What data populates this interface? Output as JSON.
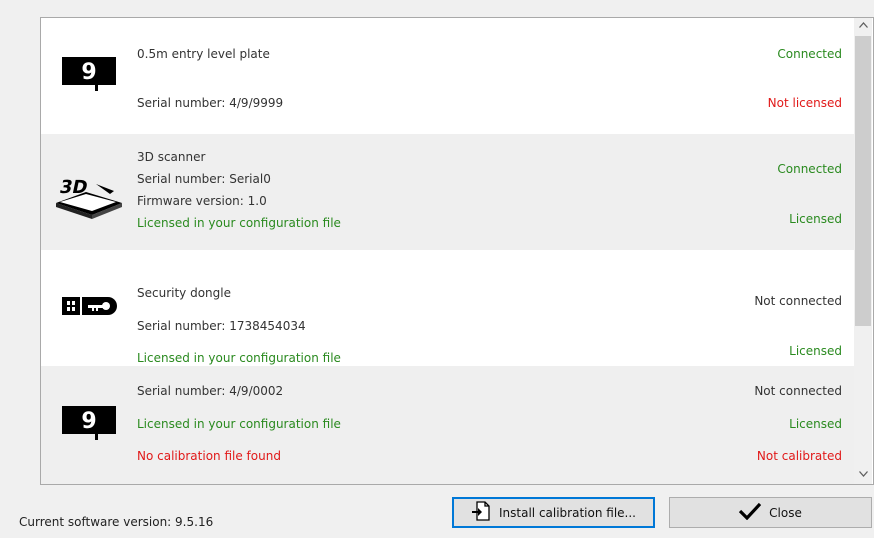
{
  "devices": [
    {
      "icon": "number-9-plate-icon",
      "name": "0.5m entry level plate",
      "serial": "Serial number: 4/9/9999",
      "connection": "Connected",
      "license": "Not licensed"
    },
    {
      "icon": "3d-scanner-icon",
      "name": "3D scanner",
      "serial": "Serial number: Serial0",
      "firmware": "Firmware version: 1.0",
      "license_note": "Licensed in your configuration file",
      "connection": "Connected",
      "license": "Licensed"
    },
    {
      "icon": "security-dongle-icon",
      "name": "Security dongle",
      "serial": "Serial number: 1738454034",
      "license_note": "Licensed in your configuration file",
      "connection": "Not connected",
      "license": "Licensed"
    },
    {
      "icon": "number-9-plate-icon",
      "serial": "Serial number: 4/9/0002",
      "license_note": "Licensed in your configuration file",
      "calibration_note": "No calibration file found",
      "connection": "Not connected",
      "license": "Licensed",
      "calibration": "Not calibrated"
    }
  ],
  "plate_icon_glyph": "9",
  "scanner_icon_text": "3D",
  "footer": {
    "version": "Current software version: 9.5.16",
    "install_label": "Install calibration file...",
    "close_label": "Close"
  },
  "colors": {
    "green": "#2a8a1f",
    "red": "#e11919",
    "accent": "#0078d7"
  }
}
